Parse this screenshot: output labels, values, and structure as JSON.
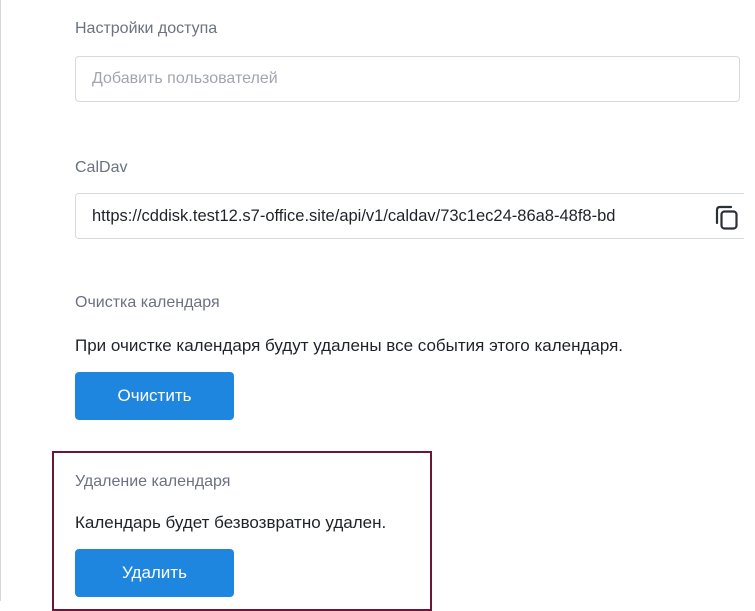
{
  "access": {
    "label": "Настройки доступа",
    "placeholder": "Добавить пользователей"
  },
  "caldav": {
    "label": "CalDav",
    "url": "https://cddisk.test12.s7-office.site/api/v1/caldav/73c1ec24-86a8-48f8-bd"
  },
  "clear": {
    "label": "Очистка календаря",
    "description": "При очистке календаря будут удалены все события этого календаря.",
    "button_label": "Очистить"
  },
  "delete": {
    "label": "Удаление календаря",
    "description": "Календарь будет безвозвратно удален.",
    "button_label": "Удалить"
  },
  "colors": {
    "accent": "#1f86e0",
    "highlight_border": "#6b1636"
  },
  "icons": {
    "copy": "copy-icon"
  }
}
